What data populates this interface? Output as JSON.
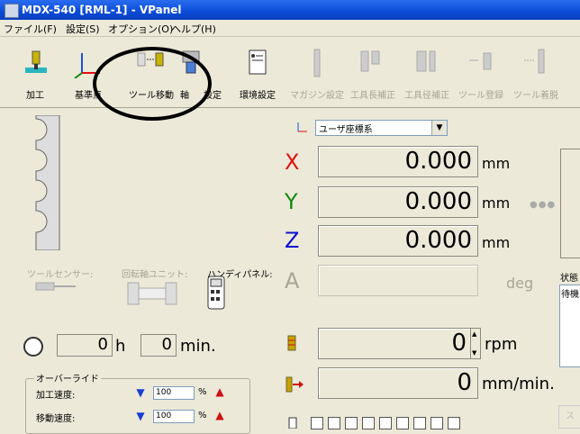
{
  "window": {
    "title": "MDX-540  [RML-1] - VPanel"
  },
  "menu": [
    "ファイル(F)",
    "設定(S)",
    "オプション(O)",
    "ヘルプ(H)"
  ],
  "toolbar": [
    {
      "label": "加工",
      "enabled": true
    },
    {
      "label": "基準点",
      "enabled": true
    },
    {
      "label": "ツール移動",
      "enabled": true
    },
    {
      "label": "軸",
      "enabled": true
    },
    {
      "label": "設定",
      "enabled": true
    },
    {
      "label": "環境設定",
      "enabled": true
    },
    {
      "label": "マガジン設定",
      "enabled": false
    },
    {
      "label": "工具長補正",
      "enabled": false
    },
    {
      "label": "工具径補正",
      "enabled": false
    },
    {
      "label": "ツール登録",
      "enabled": false
    },
    {
      "label": "ツール着脱",
      "enabled": false
    }
  ],
  "coord_system": {
    "selected": "ユーザ座標系"
  },
  "axes": [
    {
      "letter": "X",
      "value": "0.000",
      "unit": "mm",
      "color": "#e01010"
    },
    {
      "letter": "Y",
      "value": "0.000",
      "unit": "mm",
      "color": "#108a10"
    },
    {
      "letter": "Z",
      "value": "0.000",
      "unit": "mm",
      "color": "#1010d0"
    },
    {
      "letter": "A",
      "value": "",
      "unit": "deg",
      "color": "#a8a595"
    }
  ],
  "sensors": {
    "tool_sensor": "ツールセンサー:",
    "rotary_unit": "回転軸ユニット:",
    "handy_panel": "ハンディパネル:"
  },
  "timer": {
    "hours": "0",
    "h_label": "h",
    "minutes": "0",
    "min_label": "min."
  },
  "spindle": {
    "value": "0",
    "unit": "rpm"
  },
  "feed": {
    "value": "0",
    "unit": "mm/min."
  },
  "override": {
    "title": "オーバーライド",
    "rows": [
      {
        "label": "加工速度:",
        "value": "100",
        "unit": "%"
      },
      {
        "label": "移動速度:",
        "value": "100",
        "unit": "%"
      }
    ]
  },
  "status": {
    "label": "状態",
    "value": "待機"
  },
  "partial_button": "ス",
  "ellipsis": "●●●"
}
